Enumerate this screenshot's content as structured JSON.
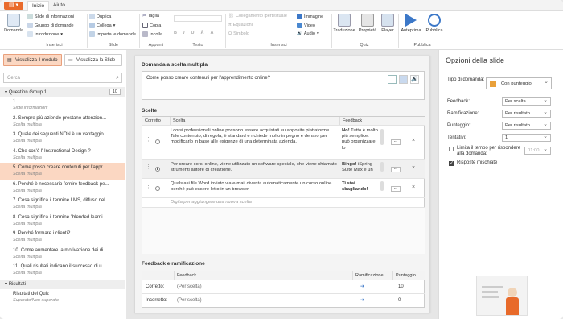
{
  "tabs": [
    "Inizio",
    "Aiuto"
  ],
  "ribbon": {
    "domanda": "Domanda",
    "inserisci_items": [
      "Slide di informazioni",
      "Gruppo di domande",
      "Introduzione"
    ],
    "inserisci_label": "Inserisci",
    "slide_items": [
      "Duplica",
      "Collega",
      "Importa le domande"
    ],
    "slide_label": "Slide",
    "appunti_items": [
      "Taglia",
      "Copia",
      "Incolla"
    ],
    "appunti_label": "Appunti",
    "testo_letters": [
      "B",
      "I",
      "U",
      "Ā",
      "A"
    ],
    "testo_label": "Testo",
    "inserisci2_items": [
      "Collegamento ipertestuale",
      "Equazioni",
      "Simbolo"
    ],
    "media_items": [
      "Immagine",
      "Video",
      "Audio"
    ],
    "inserisci2_label": "Inserisci",
    "quiz_items": [
      "Traduzione",
      "Proprietà",
      "Player"
    ],
    "quiz_label": "Quiz",
    "pub_items": [
      "Anteprima",
      "Pubblica"
    ],
    "pub_label": "Pubblica"
  },
  "left": {
    "btn_module": "Visualizza il modulo",
    "btn_slide": "Visualizza la Slide",
    "search_placeholder": "Cerca",
    "group1": "Question Group 1",
    "group1_count": "10",
    "items": [
      {
        "t": "1.",
        "s": "Slide informazioni"
      },
      {
        "t": "2. Sempre più aziende prestano attenzion...",
        "s": "Scelta multipla"
      },
      {
        "t": "3. Quale dei seguenti NON è un vantaggio...",
        "s": "Scelta multipla"
      },
      {
        "t": "4. Che cos'è l' Instructional Design ?",
        "s": "Scelta multipla"
      },
      {
        "t": "5. Come posso creare contenuti per l'appr...",
        "s": "Scelta multipla"
      },
      {
        "t": "6. Perché è necessario fornire feedback pe...",
        "s": "Scelta multipla"
      },
      {
        "t": "7. Cosa significa il termine LMS, diffuso nel...",
        "s": "Scelta multipla"
      },
      {
        "t": "8. Cosa significa il termine \"blended learni...",
        "s": "Scelta multipla"
      },
      {
        "t": "9. Perché formare i clienti?",
        "s": "Scelta multipla"
      },
      {
        "t": "10. Come aumentare la motivazione dei di...",
        "s": "Scelta multipla"
      },
      {
        "t": "11. Quali risultati indicano il successo di u...",
        "s": "Scelta multipla"
      }
    ],
    "group2": "Risultati",
    "results_item": {
      "t": "Risultati del Quiz",
      "s": "Superato/Non superato"
    }
  },
  "center": {
    "section_title": "Domanda a scelta multipla",
    "question": "Come posso creare contenuti per l'apprendimento online?",
    "choices_title": "Scelte",
    "col_correct": "Corretto",
    "col_choice": "Scelta",
    "col_feedback": "Feedback",
    "choices": [
      {
        "text": "I corsi professionali online possono essere acquistati su apposite piattaforme. Tale contenuto, di regola, è standard e richiede molto impegno e denaro per modificarlo in base alle esigenze di una determinata azienda.",
        "fb_bold": "No!",
        "fb": " Tutto è molto più semplice: può organizzare lo"
      },
      {
        "text": "Per creare corsi online, viene utilizzato un software speciale, che viene chiamato strumenti autore di creazione.",
        "fb_bold": "Bingo!",
        "fb": " iSpring Suite Max è un"
      },
      {
        "text": "Qualsiasi file Word inviato via e-mail diventa automaticamente un corso online perché può essere letto in un browser.",
        "fb_bold": "Ti stai sbagliando!",
        "fb": ""
      }
    ],
    "add_choice": "Digita per aggiungere una nuova scelta",
    "fb_title": "Feedback e ramificazione",
    "fb_col_feedback": "Feedback",
    "fb_col_branch": "Ramificazione",
    "fb_col_score": "Punteggio",
    "fb_rows": [
      {
        "label": "Corretto:",
        "fb": "(Per scelta)",
        "score": "10"
      },
      {
        "label": "Incorretto:",
        "fb": "(Per scelta)",
        "score": "0"
      }
    ]
  },
  "right": {
    "title": "Opzioni della slide",
    "type_label": "Tipo di domanda:",
    "type_value": "Con punteggio",
    "rows": [
      {
        "label": "Feedback:",
        "value": "Per scelta"
      },
      {
        "label": "Ramificazione:",
        "value": "Per risultato"
      },
      {
        "label": "Punteggio:",
        "value": "Per risultato"
      },
      {
        "label": "Tentativi:",
        "value": "1"
      }
    ],
    "limit_label": "Limita il tempo per rispondere alla domanda:",
    "limit_value": "01:00",
    "shuffle_label": "Risposte mischiate"
  }
}
